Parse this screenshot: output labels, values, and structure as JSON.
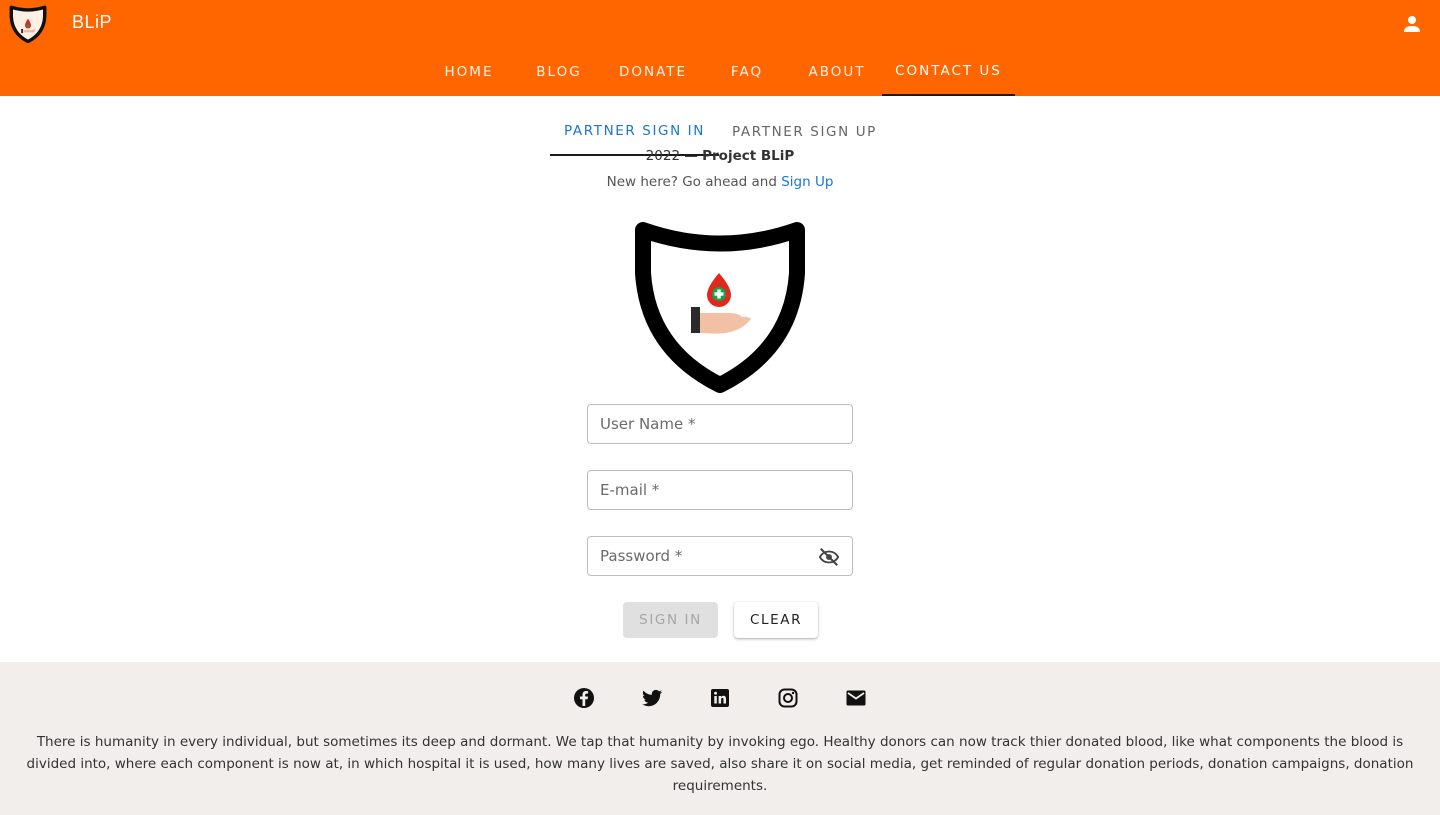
{
  "header": {
    "brand": "BLiP",
    "account_icon": "account-icon",
    "nav": [
      {
        "label": "HOME"
      },
      {
        "label": "BLOG"
      },
      {
        "label": "DONATE"
      },
      {
        "label": "FAQ"
      },
      {
        "label": "ABOUT"
      },
      {
        "label": "CONTACT US",
        "active": true
      }
    ],
    "brand_color": "#ff6600"
  },
  "tabs": [
    {
      "label": "PARTNER SIGN IN",
      "active": true
    },
    {
      "label": "PARTNER SIGN UP"
    }
  ],
  "signup_hint": {
    "text": "New here? Go ahead and ",
    "link": "Sign Up"
  },
  "form": {
    "username_placeholder": "User Name *",
    "email_placeholder": "E-mail *",
    "password_placeholder": "Password *",
    "password_toggle_icon": "visibility-off-icon",
    "signin_label": "SIGN IN",
    "clear_label": "CLEAR"
  },
  "footer": {
    "social_icons": [
      "facebook-icon",
      "twitter-icon",
      "linkedin-icon",
      "instagram-icon",
      "email-icon"
    ],
    "about_text": "There is humanity in every individual, but sometimes its deep and dormant. We tap that humanity by invoking ego. Healthy donors can now track thier donated blood, like what components the blood is divided into, where each component is now at, in which hospital it is used, how many lives are saved, also share it on social media, get reminded of regular donation periods, donation campaigns, donation requirements.",
    "copyright_year": "2022 —",
    "copyright_name": "Project BLiP"
  },
  "colors": {
    "accent": "#ff6600",
    "link": "#1976d2",
    "footer_bg": "#f1eeec"
  }
}
